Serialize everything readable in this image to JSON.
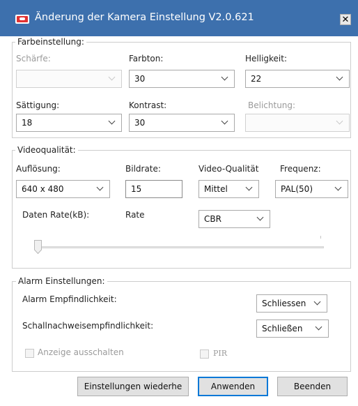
{
  "window": {
    "title": "Änderung der Kamera Einstellung V2.0.621",
    "close_glyph": "✕"
  },
  "color_settings": {
    "legend": "Farbeinstellung:",
    "sharpness": {
      "label": "Schärfe:",
      "value": ""
    },
    "hue": {
      "label": "Farbton:",
      "value": "30"
    },
    "brightness": {
      "label": "Helligkeit:",
      "value": "22"
    },
    "saturation": {
      "label": "Sättigung:",
      "value": "18"
    },
    "contrast": {
      "label": "Kontrast:",
      "value": "30"
    },
    "exposure": {
      "label": "Belichtung:",
      "value": ""
    }
  },
  "video_quality": {
    "legend": "Videoqualität:",
    "resolution": {
      "label": "Auflösung:",
      "value": "640 x 480"
    },
    "framerate": {
      "label": "Bildrate:",
      "value": "15"
    },
    "quality": {
      "label": "Video-Qualität",
      "value": "Mittel"
    },
    "frequency": {
      "label": "Frequenz:",
      "value": "PAL(50)"
    },
    "data_rate_label": "Daten Rate(kB):",
    "rate_label": "Rate",
    "rate_mode": "CBR",
    "slider_level": 0
  },
  "alarm": {
    "legend": "Alarm Einstellungen:",
    "sensitivity_label": "Alarm Empfindlichkeit:",
    "sensitivity_value": "Schliessen",
    "sound_label": "Schallnachweisempfindlichkeit:",
    "sound_value": "Schließen",
    "hide_display_label": "Anzeige ausschalten",
    "pir_label": "PIR"
  },
  "buttons": {
    "restore": "Einstellungen wiederhe",
    "apply": "Anwenden",
    "quit": "Beenden"
  },
  "colors": {
    "titlebar": "#3d70ad",
    "focus_border": "#0078d7"
  }
}
